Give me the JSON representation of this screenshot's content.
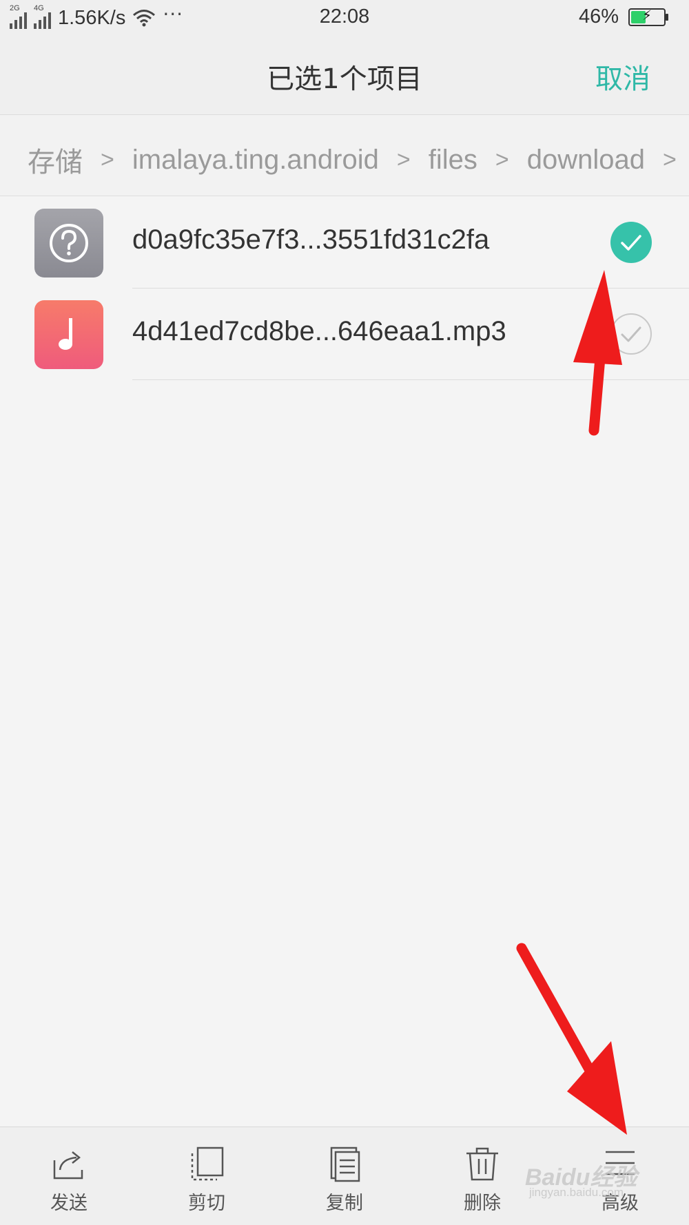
{
  "status_bar": {
    "signal1_tag": "2G",
    "signal2_tag": "4G",
    "speed": "1.56K/s",
    "more": "···",
    "time": "22:08",
    "battery": "46%",
    "battery_level": 0.46,
    "battery_color": "#2ed06a"
  },
  "header": {
    "title": "已选1个项目",
    "cancel_label": "取消",
    "accent_color": "#2fb8a7"
  },
  "breadcrumb": {
    "items": [
      "存储",
      "ximalaya.ting.android",
      "files",
      "download"
    ],
    "separator": ">"
  },
  "files": [
    {
      "name": "d0a9fc35e7f3...3551fd31c2fa",
      "icon": "unknown-file-icon",
      "selected": true
    },
    {
      "name": "4d41ed7cd8be...646eaa1.mp3",
      "icon": "music-file-icon",
      "selected": false
    }
  ],
  "bottom_bar": {
    "send": "发送",
    "cut": "剪切",
    "copy": "复制",
    "delete": "删除",
    "advanced": "高级"
  },
  "watermark": {
    "brand": "Baidu经验",
    "url": "jingyan.baidu.com"
  }
}
